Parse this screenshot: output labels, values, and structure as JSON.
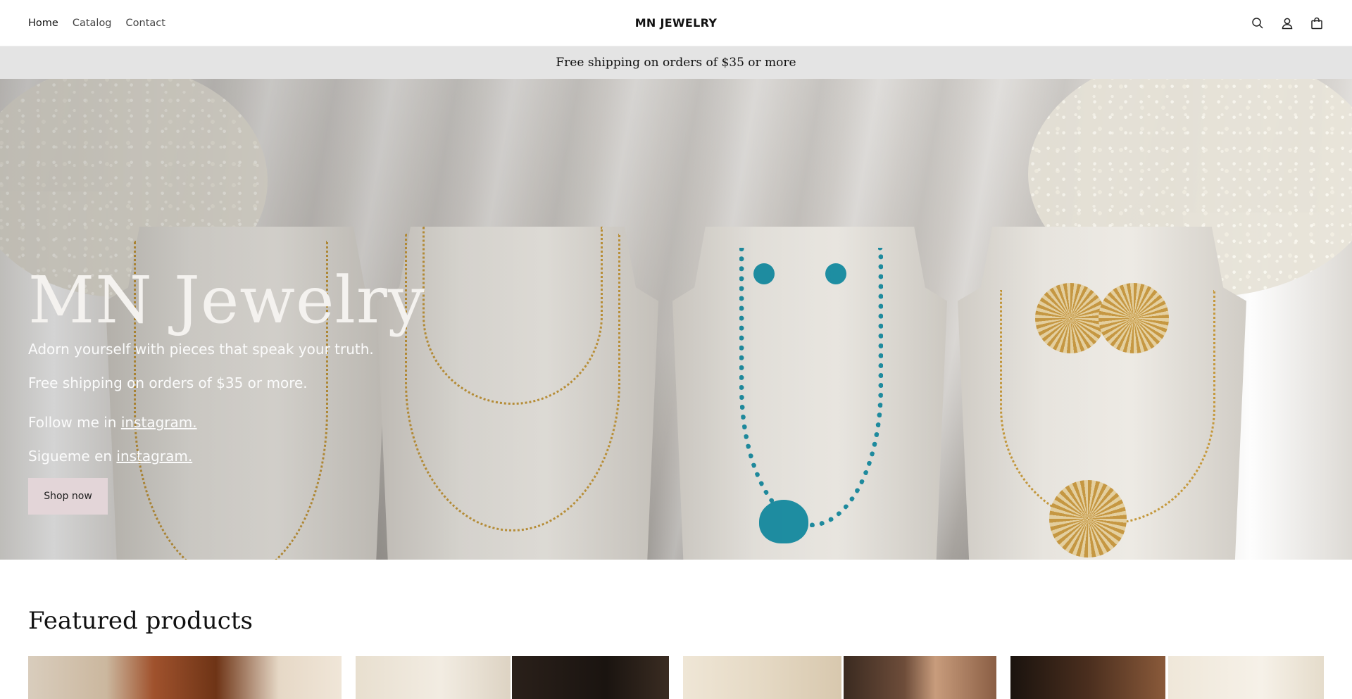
{
  "header": {
    "nav": [
      {
        "label": "Home",
        "active": true
      },
      {
        "label": "Catalog",
        "active": false
      },
      {
        "label": "Contact",
        "active": false
      }
    ],
    "brand": "MN JEWELRY",
    "icons": [
      "search-icon",
      "account-icon",
      "cart-icon"
    ]
  },
  "announcement": {
    "text": "Free shipping on orders of $35 or more"
  },
  "hero": {
    "title": "MN Jewelry",
    "line1": "Adorn yourself with pieces that speak your truth.",
    "line2": "Free shipping on orders of $35 or more.",
    "line3_prefix": "Follow me in ",
    "line3_link": "instagram.",
    "line4_prefix": "Sigueme en ",
    "line4_link": "instagram.",
    "button": "Shop now",
    "button_color": "#e3d5d8"
  },
  "featured": {
    "title": "Featured products"
  },
  "colors": {
    "announcement_bg": "#e4e4e4",
    "brand_text": "#111111"
  }
}
